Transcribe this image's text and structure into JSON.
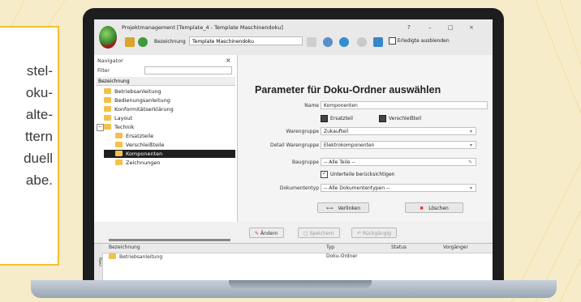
{
  "side_text": {
    "lines": [
      "stel-",
      "oku-",
      "alte-",
      "ttern",
      "duell",
      "abe."
    ]
  },
  "window": {
    "title": "Projektmanagement [Template_4 - Template Maschinendoku]",
    "controls": [
      "?",
      "–",
      "□",
      "×"
    ]
  },
  "toolbar": {
    "label": "Bezeichnung",
    "value": "Template Maschinendoku",
    "checkbox_label": "Erledigte ausblenden"
  },
  "navigator": {
    "title": "Navigator",
    "close": "×",
    "filter_label": "Filter",
    "column": "Bezeichnung",
    "items": [
      {
        "label": "Betriebsanleitung",
        "level": 0
      },
      {
        "label": "Bedienungsanleitung",
        "level": 0
      },
      {
        "label": "Konformitätserklärung",
        "level": 0
      },
      {
        "label": "Layout",
        "level": 0
      },
      {
        "label": "Technik",
        "level": 0
      },
      {
        "label": "Ersatzteile",
        "level": 1
      },
      {
        "label": "Verschleißteile",
        "level": 1
      },
      {
        "label": "Komponenten",
        "level": 1,
        "selected": true
      },
      {
        "label": "Zeichnungen",
        "level": 1
      }
    ],
    "expander": "−"
  },
  "form": {
    "title": "Parameter für Doku-Ordner auswählen",
    "name_label": "Name",
    "name_value": "Komponenten",
    "check_ersatzteil": "Ersatzteil",
    "check_verschleiss": "Verschleißteil",
    "warengruppe_label": "Warengruppe",
    "warengruppe_value": "Zukaufteil",
    "detail_label": "Detail Warengruppe",
    "detail_value": "Elektrokomponenten",
    "baugruppe_label": "Baugruppe",
    "baugruppe_value": "-- Alle Teile --",
    "unterteile_label": "Unterteile berücksichtigen",
    "dokumententyp_label": "Dokumententyp",
    "dokumententyp_value": "-- Alle Dokumententypen --",
    "btn_verlinken": "Verlinken",
    "btn_loeschen": "Löschen"
  },
  "bottom_toolbar": {
    "aendern": "Ändern",
    "btn2": "Speichern",
    "btn3": "Rückgängig"
  },
  "grid": {
    "side_label": "Navi",
    "headers": [
      "Bezeichnung",
      "Typ",
      "Status",
      "Vorgänger"
    ],
    "row": [
      "Betriebsanleitung",
      "Doku-Ordner",
      "",
      ""
    ]
  },
  "colors": {
    "background": "#f6ecc9",
    "accent": "#f2c032",
    "bezel": "#1d1d1f",
    "folder": "#f3c14a"
  }
}
